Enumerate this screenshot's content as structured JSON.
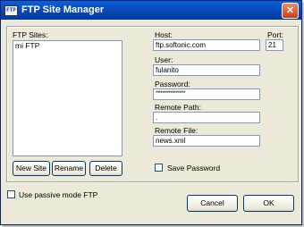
{
  "window": {
    "title": "FTP Site Manager",
    "icon_label": "FTP",
    "close_label": "✕"
  },
  "sites": {
    "label": "FTP Sites:",
    "items": [
      "mi FTP"
    ]
  },
  "host": {
    "label": "Host:",
    "value": "ftp.softonic.com"
  },
  "port": {
    "label": "Port:",
    "value": "21"
  },
  "user": {
    "label": "User:",
    "value": "fulanito"
  },
  "password": {
    "label": "Password:",
    "value": "******************"
  },
  "remote_path": {
    "label": "Remote Path:",
    "value": "."
  },
  "remote_file": {
    "label": "Remote File:",
    "value": "news.xml"
  },
  "buttons": {
    "new_site": "New Site",
    "rename": "Rename",
    "delete": "Delete",
    "cancel": "Cancel",
    "ok": "OK"
  },
  "save_password": {
    "label": "Save Password",
    "checked": false
  },
  "passive_mode": {
    "label": "Use passive mode FTP",
    "checked": false
  }
}
